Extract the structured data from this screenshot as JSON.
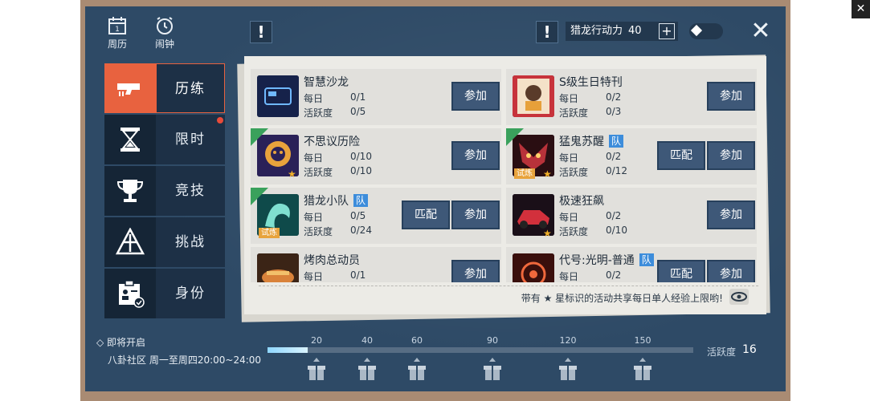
{
  "top": {
    "calendar_label": "周历",
    "clock_label": "闹钟",
    "calendar_day": "1",
    "excl": "!",
    "stamina_label": "猎龙行动力",
    "stamina_value": "40",
    "plus": "+",
    "close": "✕"
  },
  "tabs": [
    {
      "label": "历练",
      "icon": "gun-icon",
      "active": true
    },
    {
      "label": "限时",
      "icon": "hourglass-icon"
    },
    {
      "label": "竞技",
      "icon": "trophy-icon"
    },
    {
      "label": "挑战",
      "icon": "challenge-icon"
    },
    {
      "label": "身份",
      "icon": "id-card-icon"
    }
  ],
  "labels": {
    "daily": "每日",
    "activity": "活跃度",
    "join": "参加",
    "match": "匹配",
    "team": "队",
    "recommend": "推荐",
    "trial": "试炼",
    "star": "★"
  },
  "activities": [
    {
      "name": "智慧沙龙",
      "daily": "0/1",
      "activity": "0/5"
    },
    {
      "name": "S级生日特刊",
      "daily": "0/2",
      "activity": "0/3"
    },
    {
      "name": "不思议历险",
      "daily": "0/10",
      "activity": "0/10"
    },
    {
      "name": "猛鬼苏醒",
      "daily": "0/2",
      "activity": "0/12"
    },
    {
      "name": "猎龙小队",
      "daily": "0/5",
      "activity": "0/24"
    },
    {
      "name": "极速狂飙",
      "daily": "0/2",
      "activity": "0/10"
    },
    {
      "name": "烤肉总动员",
      "daily": "0/1",
      "activity": ""
    },
    {
      "name": "代号:光明-普通",
      "daily": "0/2",
      "activity": ""
    }
  ],
  "note": "带有 ★ 星标识的活动共享每日单人经验上限哟!",
  "upcoming": {
    "title": "即将开启",
    "detail": "八卦社区 周一至周四20:00~24:00"
  },
  "progress": {
    "milestones": [
      "20",
      "40",
      "60",
      "90",
      "120",
      "150"
    ],
    "label": "活跃度",
    "value": 16,
    "max": 160
  },
  "colors": {
    "accent": "#e8623f",
    "board": "#2e4a66",
    "button": "#3e5878",
    "recommend": "#3aa15c",
    "team": "#3d8ddb"
  }
}
